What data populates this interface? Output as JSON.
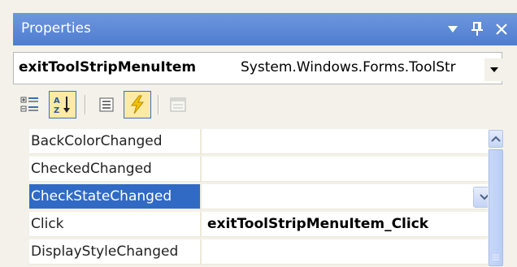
{
  "window": {
    "title": "Properties",
    "buttons": [
      {
        "name": "dropdown-icon",
        "glyph": "▾"
      },
      {
        "name": "pin-icon",
        "glyph": "ᵖ"
      },
      {
        "name": "close-icon",
        "glyph": "✕"
      }
    ]
  },
  "object_selector": {
    "name": "exitToolStripMenuItem",
    "type": "System.Windows.Forms.ToolStr"
  },
  "toolbar": {
    "tools": [
      {
        "name": "categorized-icon",
        "active": false
      },
      {
        "name": "alphabetical-icon",
        "active": true
      },
      {
        "name": "properties-icon",
        "active": false
      },
      {
        "name": "events-icon",
        "active": true
      },
      {
        "name": "property-pages-icon",
        "active": false
      }
    ]
  },
  "grid": {
    "rows": [
      {
        "name": "BackColorChanged",
        "value": ""
      },
      {
        "name": "CheckedChanged",
        "value": ""
      },
      {
        "name": "CheckStateChanged",
        "value": "",
        "selected": true
      },
      {
        "name": "Click",
        "value": "exitToolStripMenuItem_Click"
      },
      {
        "name": "DisplayStyleChanged",
        "value": ""
      }
    ]
  },
  "colors": {
    "titlebar": "#4f7cd0",
    "selection": "#316ac5",
    "panel": "#f3f1e9"
  }
}
